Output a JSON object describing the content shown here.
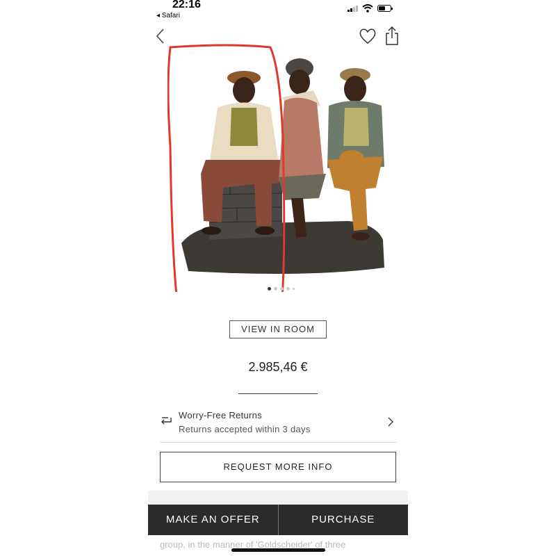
{
  "status_bar": {
    "time": "22:16",
    "back_app": "◂ Safari"
  },
  "nav": {
    "back_icon": "chevron-left-icon",
    "favorite_icon": "heart-icon",
    "share_icon": "share-icon"
  },
  "gallery": {
    "image_count": 5,
    "active_index": 0
  },
  "view_in_room_label": "VIEW IN ROOM",
  "price": "2.985,46 €",
  "returns": {
    "title": "Worry-Free Returns",
    "subtitle": "Returns accepted within 3 days"
  },
  "request_info_label": "REQUEST MORE INFO",
  "actions": {
    "offer_label": "MAKE AN OFFER",
    "purchase_label": "PURCHASE"
  },
  "description_snippet": "group, in the manner of 'Goldscheider' of three",
  "colors": {
    "accent_dark": "#2b2b2b",
    "annotation_red": "#e0392b"
  }
}
